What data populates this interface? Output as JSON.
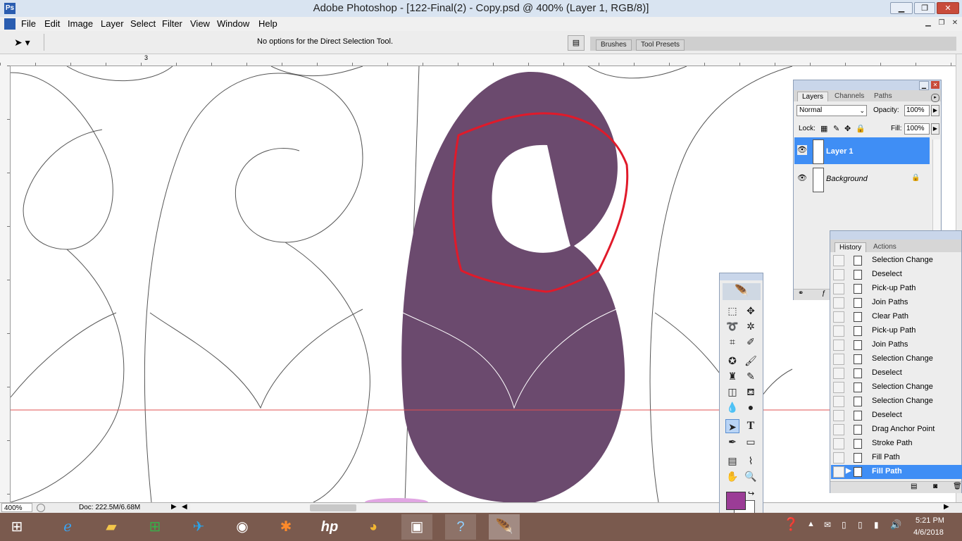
{
  "window": {
    "title": "Adobe Photoshop - [122-Final(2) - Copy.psd @ 400% (Layer 1, RGB/8)]",
    "minimize": "▁",
    "restore": "❐",
    "close": "✕"
  },
  "menu": [
    "File",
    "Edit",
    "Image",
    "Layer",
    "Select",
    "Filter",
    "View",
    "Window",
    "Help"
  ],
  "options_bar": {
    "message": "No options for the Direct Selection Tool.",
    "well_tabs": [
      "Brushes",
      "Tool Presets"
    ]
  },
  "ruler": {
    "mark": "3"
  },
  "layers_panel": {
    "tabs": [
      "Layers",
      "Channels",
      "Paths"
    ],
    "blend_mode": "Normal",
    "opacity_label": "Opacity:",
    "opacity_value": "100%",
    "lock_label": "Lock:",
    "fill_label": "Fill:",
    "fill_value": "100%",
    "layers": [
      {
        "name": "Layer 1",
        "selected": true
      },
      {
        "name": "Background",
        "selected": false
      }
    ]
  },
  "history_panel": {
    "tabs": [
      "History",
      "Actions"
    ],
    "items": [
      "Selection Change",
      "Deselect",
      "Pick-up Path",
      "Join Paths",
      "Clear Path",
      "Pick-up Path",
      "Join Paths",
      "Selection Change",
      "Deselect",
      "Selection Change",
      "Selection Change",
      "Deselect",
      "Drag Anchor Point",
      "Stroke Path",
      "Fill Path",
      "Fill Path"
    ],
    "selected_index": 15
  },
  "toolbox": {
    "foreground_color": "#9b3c96",
    "background_color": "#ffffff",
    "type_tool_glyph": "T"
  },
  "status_bar": {
    "zoom": "400%",
    "doc_info": "Doc: 222.5M/6.68M"
  },
  "canvas": {
    "shape_fill": "#6b4a6e",
    "selection_stroke": "#e01a2a",
    "guide_color": "#e05050"
  },
  "taskbar": {
    "time": "5:21 PM",
    "date": "4/6/2018"
  }
}
